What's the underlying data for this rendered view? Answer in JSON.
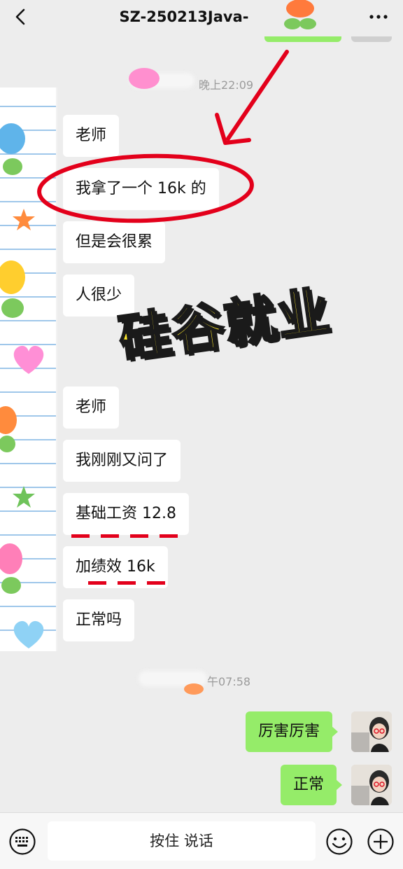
{
  "header": {
    "title": "SZ-250213Java-"
  },
  "timestamps": [
    "晚上22:09",
    "午07:58"
  ],
  "messages_left": [
    "老师",
    "我拿了一个 16k 的",
    "但是会很累",
    "人很少",
    "老师",
    "我刚刚又问了",
    "基础工资 12.8",
    "加绩效 16k",
    "正常吗"
  ],
  "messages_right": [
    "厉害厉害",
    "正常"
  ],
  "overlay": {
    "text": "硅谷就业"
  },
  "input_bar": {
    "voice_label": "按住 说话"
  },
  "colors": {
    "self_bubble": "#95ec69",
    "annotation": "#e3001b",
    "overlay_fill": "#ffea2e"
  }
}
